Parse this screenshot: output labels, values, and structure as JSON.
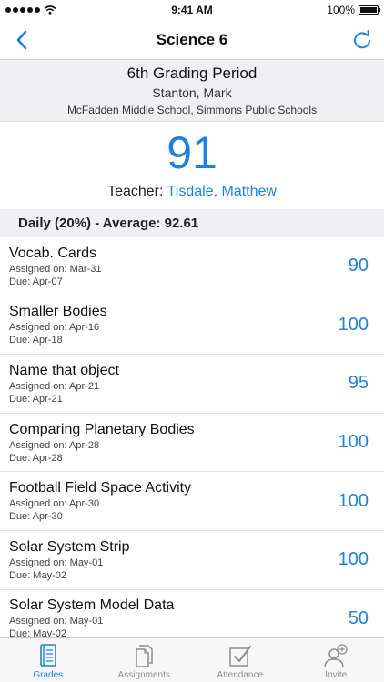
{
  "status_bar": {
    "time": "9:41 AM",
    "battery": "100%"
  },
  "nav": {
    "title": "Science 6",
    "back_icon": "chevron-left-icon",
    "refresh_icon": "refresh-icon"
  },
  "period": {
    "title": "6th Grading Period",
    "student": "Stanton, Mark",
    "school": "McFadden Middle School, Simmons Public Schools"
  },
  "grade": {
    "value": "91",
    "teacher_label": "Teacher:",
    "teacher_name": "Tisdale, Matthew"
  },
  "section": {
    "title": "Daily (20%) - Average: 92.61"
  },
  "assignments": [
    {
      "title": "Vocab. Cards",
      "assigned": "Assigned on: Mar-31",
      "due": "Due: Apr-07",
      "score": "90"
    },
    {
      "title": "Smaller Bodies",
      "assigned": "Assigned on: Apr-16",
      "due": "Due: Apr-18",
      "score": "100"
    },
    {
      "title": "Name that object",
      "assigned": "Assigned on: Apr-21",
      "due": "Due: Apr-21",
      "score": "95"
    },
    {
      "title": "Comparing Planetary Bodies",
      "assigned": "Assigned on: Apr-28",
      "due": "Due: Apr-28",
      "score": "100"
    },
    {
      "title": "Football Field Space Activity",
      "assigned": "Assigned on: Apr-30",
      "due": "Due: Apr-30",
      "score": "100"
    },
    {
      "title": "Solar System Strip",
      "assigned": "Assigned on: May-01",
      "due": "Due: May-02",
      "score": "100"
    },
    {
      "title": "Solar System Model Data",
      "assigned": "Assigned on: May-01",
      "due": "Due: May-02",
      "score": "50"
    }
  ],
  "tabs": [
    {
      "label": "Grades",
      "icon": "notebook-icon",
      "active": true
    },
    {
      "label": "Assignments",
      "icon": "documents-icon",
      "active": false
    },
    {
      "label": "Attendance",
      "icon": "checkbox-icon",
      "active": false
    },
    {
      "label": "Invite",
      "icon": "add-user-icon",
      "active": false
    }
  ],
  "colors": {
    "accent": "#1a82e2",
    "header_bg": "#efeff4"
  }
}
